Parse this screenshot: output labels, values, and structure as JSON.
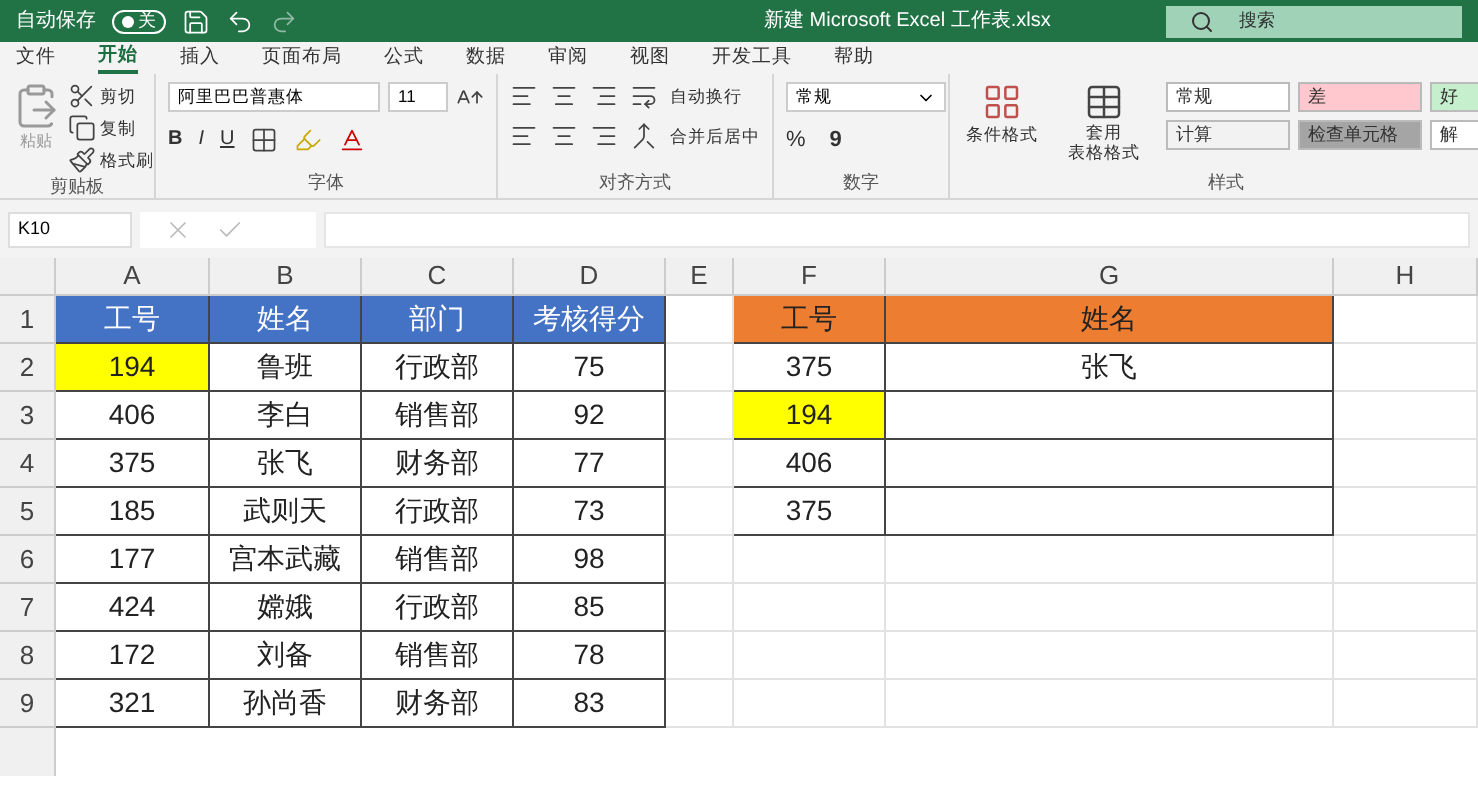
{
  "title_bar": {
    "autosave_label": "自动保存",
    "autosave_state": "关",
    "autosave_on": false,
    "title": "新建 Microsoft Excel 工作表.xlsx",
    "search_placeholder": "搜索"
  },
  "ribbon_tabs": [
    {
      "label": "文件",
      "selected": false
    },
    {
      "label": "开始",
      "selected": true
    },
    {
      "label": "插入",
      "selected": false
    },
    {
      "label": "页面布局",
      "selected": false
    },
    {
      "label": "公式",
      "selected": false
    },
    {
      "label": "数据",
      "selected": false
    },
    {
      "label": "审阅",
      "selected": false
    },
    {
      "label": "视图",
      "selected": false
    },
    {
      "label": "开发工具",
      "selected": false
    },
    {
      "label": "帮助",
      "selected": false
    }
  ],
  "clipboard": {
    "paste": "粘贴",
    "cut": "剪切",
    "copy": "复制",
    "format_painter": "格式刷",
    "label": "剪贴板"
  },
  "font": {
    "name": "阿里巴巴普惠体",
    "size": "11",
    "bold": "B",
    "italic": "I",
    "underline": "U",
    "label": "字体"
  },
  "alignment": {
    "wrap": "自动换行",
    "merge": "合并后居中",
    "label": "对齐方式"
  },
  "number": {
    "format": "常规",
    "percent": "%",
    "comma": "9",
    "label": "数字"
  },
  "styles": {
    "conditional": "条件格式",
    "table_format_1": "套用",
    "table_format_2": "表格格式",
    "label": "样式",
    "cells": [
      {
        "text": "常规",
        "color": "#ffffff"
      },
      {
        "text": "差",
        "color": "#ffc7ce"
      },
      {
        "text": "好",
        "color": "#c6efce"
      },
      {
        "text": "计算",
        "color": "#f2f2f2"
      },
      {
        "text": "检查单元格",
        "color": "#a5a5a5"
      },
      {
        "text": "解",
        "color": "#ffffff"
      }
    ]
  },
  "name_box": "K10",
  "column_headers": [
    "A",
    "B",
    "C",
    "D",
    "E",
    "F",
    "G",
    "H"
  ],
  "rows": [
    {
      "header": "1",
      "cells": [
        {
          "text": "工号",
          "color": "#4472c4",
          "bordered": true
        },
        {
          "text": "姓名",
          "color": "#4472c4",
          "bordered": true
        },
        {
          "text": "部门",
          "color": "#4472c4",
          "bordered": true
        },
        {
          "text": "考核得分",
          "color": "#4472c4",
          "bordered": true
        },
        {
          "bordered": false
        },
        {
          "text": "工号",
          "color": "#ed7d31",
          "bordered": true
        },
        {
          "text": "姓名",
          "color": "#ed7d31",
          "bordered": true
        },
        {
          "bordered": false
        }
      ]
    },
    {
      "header": "2",
      "cells": [
        {
          "text": "194",
          "color": "#ffff00",
          "bordered": true
        },
        {
          "text": "鲁班",
          "bordered": true
        },
        {
          "text": "行政部",
          "bordered": true
        },
        {
          "text": "75",
          "bordered": true
        },
        {
          "bordered": false
        },
        {
          "text": "375",
          "bordered": true
        },
        {
          "text": "张飞",
          "bordered": true
        },
        {
          "bordered": false
        }
      ]
    },
    {
      "header": "3",
      "cells": [
        {
          "text": "406",
          "bordered": true
        },
        {
          "text": "李白",
          "bordered": true
        },
        {
          "text": "销售部",
          "bordered": true
        },
        {
          "text": "92",
          "bordered": true
        },
        {
          "bordered": false
        },
        {
          "text": "194",
          "color": "#ffff00",
          "bordered": true
        },
        {
          "bordered": true
        },
        {
          "bordered": false
        }
      ]
    },
    {
      "header": "4",
      "cells": [
        {
          "text": "375",
          "bordered": true
        },
        {
          "text": "张飞",
          "bordered": true
        },
        {
          "text": "财务部",
          "bordered": true
        },
        {
          "text": "77",
          "bordered": true
        },
        {
          "bordered": false
        },
        {
          "text": "406",
          "bordered": true
        },
        {
          "bordered": true
        },
        {
          "bordered": false
        }
      ]
    },
    {
      "header": "5",
      "cells": [
        {
          "text": "185",
          "bordered": true
        },
        {
          "text": "武则天",
          "bordered": true
        },
        {
          "text": "行政部",
          "bordered": true
        },
        {
          "text": "73",
          "bordered": true
        },
        {
          "bordered": false
        },
        {
          "text": "375",
          "bordered": true
        },
        {
          "bordered": true
        },
        {
          "bordered": false
        }
      ]
    },
    {
      "header": "6",
      "cells": [
        {
          "text": "177",
          "bordered": true
        },
        {
          "text": "宫本武藏",
          "bordered": true
        },
        {
          "text": "销售部",
          "bordered": true
        },
        {
          "text": "98",
          "bordered": true
        },
        {
          "bordered": false
        },
        {
          "bordered": false
        },
        {
          "bordered": false
        },
        {
          "bordered": false
        }
      ]
    },
    {
      "header": "7",
      "cells": [
        {
          "text": "424",
          "bordered": true
        },
        {
          "text": "嫦娥",
          "bordered": true
        },
        {
          "text": "行政部",
          "bordered": true
        },
        {
          "text": "85",
          "bordered": true
        },
        {
          "bordered": false
        },
        {
          "bordered": false
        },
        {
          "bordered": false
        },
        {
          "bordered": false
        }
      ]
    },
    {
      "header": "8",
      "cells": [
        {
          "text": "172",
          "bordered": true
        },
        {
          "text": "刘备",
          "bordered": true
        },
        {
          "text": "销售部",
          "bordered": true
        },
        {
          "text": "78",
          "bordered": true
        },
        {
          "bordered": false
        },
        {
          "bordered": false
        },
        {
          "bordered": false
        },
        {
          "bordered": false
        }
      ]
    },
    {
      "header": "9",
      "cells": [
        {
          "text": "321",
          "bordered": true
        },
        {
          "text": "孙尚香",
          "bordered": true
        },
        {
          "text": "财务部",
          "bordered": true
        },
        {
          "text": "83",
          "bordered": true
        },
        {
          "bordered": false
        },
        {
          "bordered": false
        },
        {
          "bordered": false
        },
        {
          "bordered": false
        }
      ]
    }
  ]
}
